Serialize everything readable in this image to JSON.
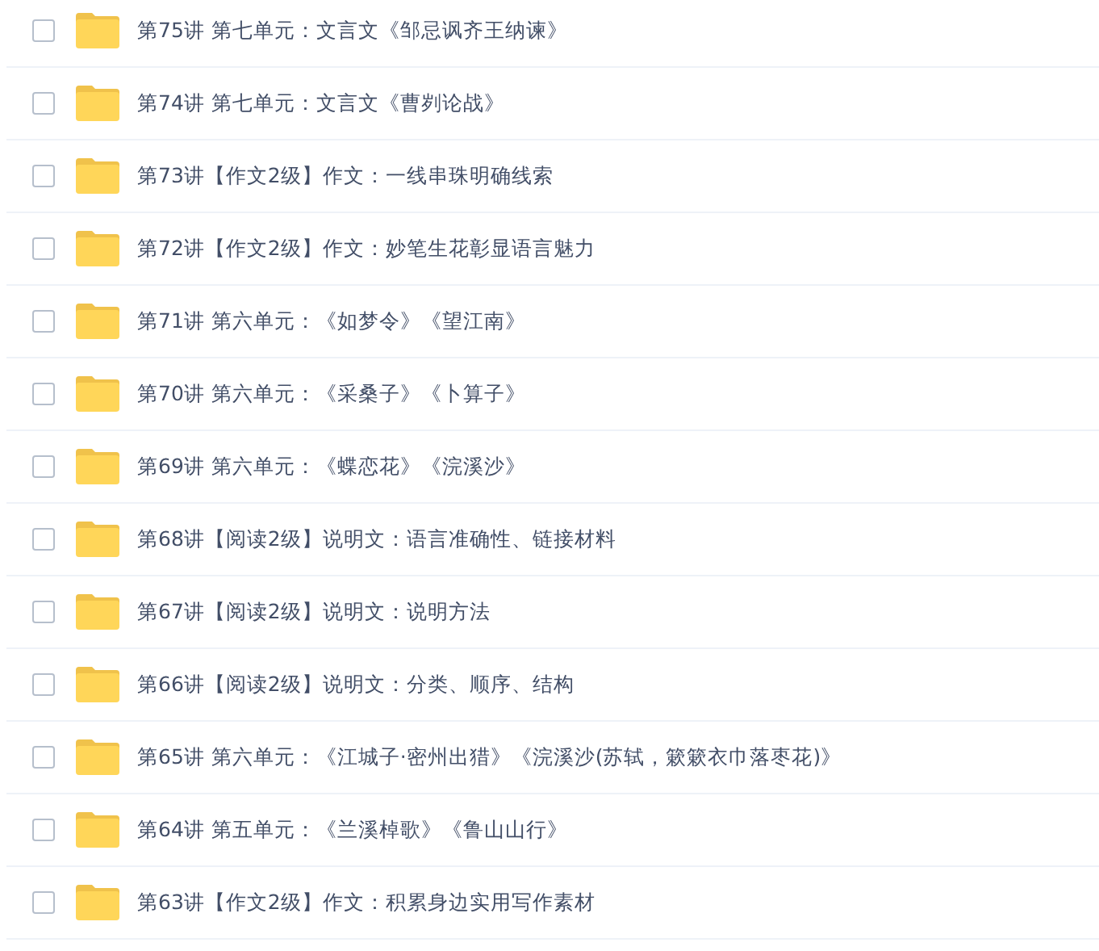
{
  "files": [
    {
      "name": "第75讲 第七单元：文言文《邹忌讽齐王纳谏》",
      "checked": false
    },
    {
      "name": "第74讲 第七单元：文言文《曹刿论战》",
      "checked": false
    },
    {
      "name": "第73讲【作文2级】作文：一线串珠明确线索",
      "checked": false
    },
    {
      "name": "第72讲【作文2级】作文：妙笔生花彰显语言魅力",
      "checked": false
    },
    {
      "name": "第71讲 第六单元：《如梦令》《望江南》",
      "checked": false
    },
    {
      "name": "第70讲 第六单元：《采桑子》《卜算子》",
      "checked": false
    },
    {
      "name": "第69讲 第六单元：《蝶恋花》《浣溪沙》",
      "checked": false
    },
    {
      "name": "第68讲【阅读2级】说明文：语言准确性、链接材料",
      "checked": false
    },
    {
      "name": "第67讲【阅读2级】说明文：说明方法",
      "checked": false
    },
    {
      "name": "第66讲【阅读2级】说明文：分类、顺序、结构",
      "checked": false
    },
    {
      "name": "第65讲 第六单元：《江城子·密州出猎》《浣溪沙(苏轼，簌簌衣巾落枣花)》",
      "checked": false
    },
    {
      "name": "第64讲 第五单元：《兰溪棹歌》《鲁山山行》",
      "checked": false
    },
    {
      "name": "第63讲【作文2级】作文：积累身边实用写作素材",
      "checked": false
    }
  ]
}
